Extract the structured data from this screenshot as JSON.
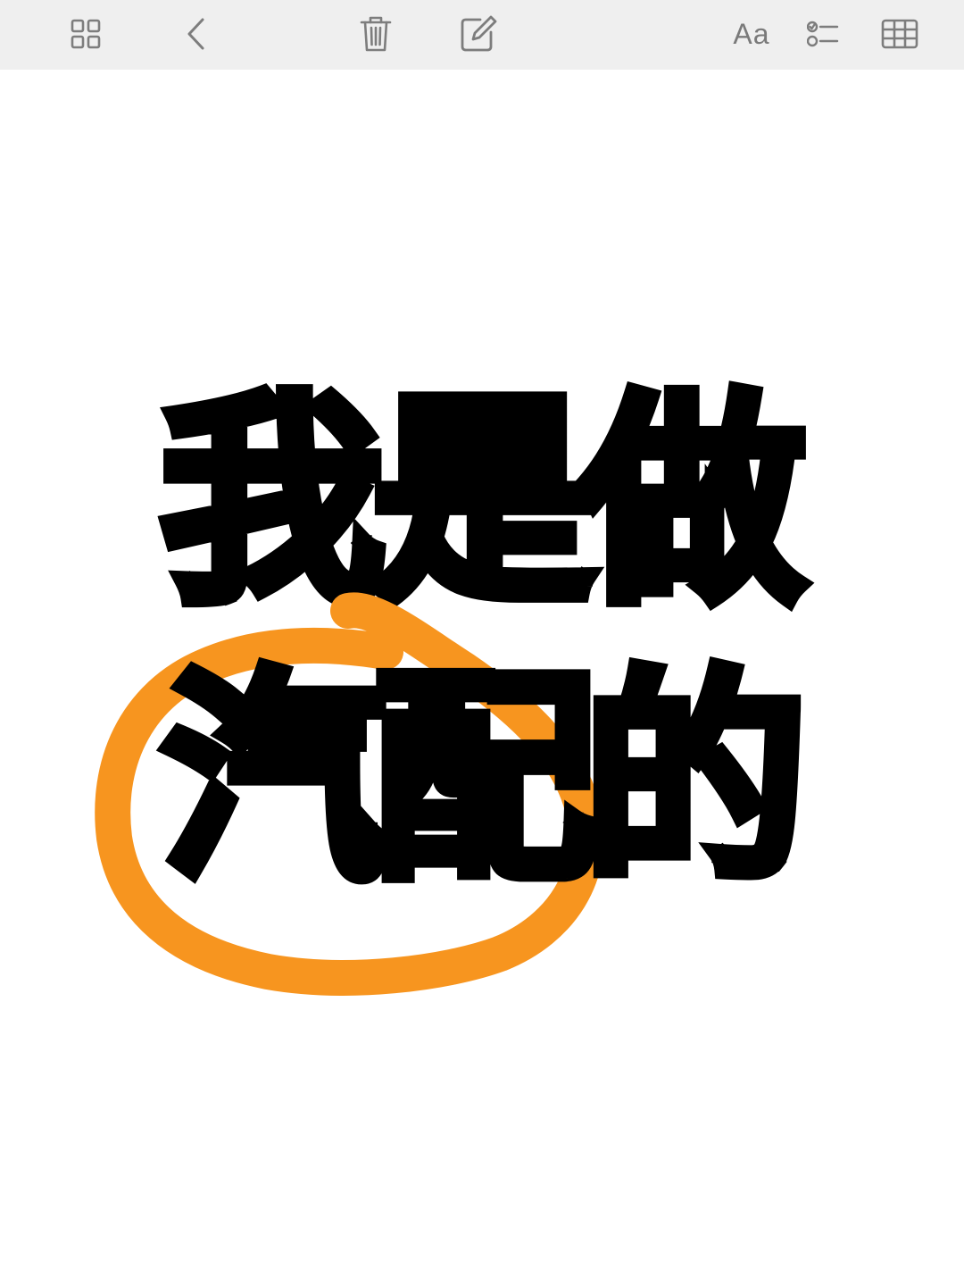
{
  "toolbar": {
    "format_label": "Aa",
    "icons": {
      "sidebar": "grid-icon",
      "back": "chevron-left-icon",
      "delete": "trash-icon",
      "compose": "compose-icon",
      "format": "text-format-icon",
      "checklist": "checklist-icon",
      "table": "table-icon"
    }
  },
  "note": {
    "line1": [
      "我",
      "是",
      "做"
    ],
    "line2": [
      "汽",
      "配",
      "的"
    ],
    "highlight_color": "#f7951f",
    "text_color": "#000000"
  }
}
